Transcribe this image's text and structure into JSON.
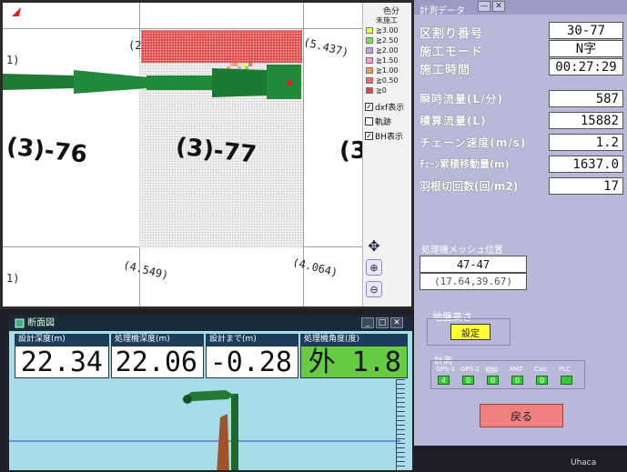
{
  "legend": {
    "title": "色分",
    "unworked": "未施工",
    "rows": [
      {
        "label": "≧3.00",
        "color": "#f5f542"
      },
      {
        "label": "≧2.50",
        "color": "#7be05a"
      },
      {
        "label": "≧2.00",
        "color": "#c9a0ff"
      },
      {
        "label": "≧1.50",
        "color": "#ff9bd0"
      },
      {
        "label": "≧1.00",
        "color": "#f0a050"
      },
      {
        "label": "≧0.50",
        "color": "#f06a6a"
      },
      {
        "label": "≧0",
        "color": "#e04848"
      }
    ],
    "checks": [
      {
        "label": "dxf表示",
        "checked": true
      },
      {
        "label": "軌跡",
        "checked": false
      },
      {
        "label": "BH表示",
        "checked": true
      }
    ]
  },
  "map": {
    "block_left": "(3)-76",
    "block_center": "(3)-77",
    "block_right": "(3",
    "coords": {
      "top_left": "(2",
      "top_right": "(5.437)",
      "bottom_left": "(4.549)",
      "bottom_right": "(4.064)",
      "left_mark_1": "1)",
      "left_mark_2": "1)"
    }
  },
  "panel": {
    "header": "計測データ",
    "rows_top": [
      {
        "label": "区割り番号",
        "value": "30-77"
      },
      {
        "label": "施工モード",
        "value": "N字"
      },
      {
        "label": "施工時間",
        "value": "00:27:29"
      }
    ],
    "rows_main": [
      {
        "label": "瞬時流量(L/分)",
        "value": "587"
      },
      {
        "label": "積算流量(L)",
        "value": "15882"
      },
      {
        "label": "チェーン速度(m/s)",
        "value": "1.2"
      },
      {
        "label": "ﾁｪｰﾝ累積移動量(m)",
        "value": "1637.0"
      },
      {
        "label": "羽根切回数(回/m2)",
        "value": "17"
      }
    ],
    "mesh_pos_label": "処理機メッシュ位置",
    "mesh_pos_value": "47-47",
    "mesh_pos_coords": "(17.64,39.67)",
    "ground_height_label": "地盤高さ",
    "settings_button": "設定",
    "measure_label": "計測",
    "sensors": [
      {
        "label": "GPS-1",
        "value": "4"
      },
      {
        "label": "GPS-2",
        "value": "0"
      },
      {
        "label": "傾斜",
        "value": "0"
      },
      {
        "label": "MAT",
        "value": "0"
      },
      {
        "label": "Calc",
        "value": "0"
      },
      {
        "label": "PLC",
        "value": ""
      }
    ],
    "back_button": "戻る"
  },
  "bottom": {
    "title": "断面図",
    "gauges": [
      {
        "label": "設計深度(m)",
        "value": "22.34",
        "color": "#ffffff"
      },
      {
        "label": "処理機深度(m)",
        "value": "22.06",
        "color": "#ffffff"
      },
      {
        "label": "設計まで(m)",
        "value": "-0.28",
        "color": "#ffffff"
      },
      {
        "label": "処理機角度(度)",
        "value": "外  1.8",
        "color": "#66cc44"
      }
    ]
  },
  "taskbar": {
    "label": "Uhaca"
  }
}
